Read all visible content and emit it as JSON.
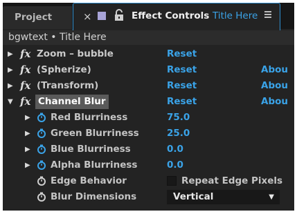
{
  "tabs": {
    "project": "Project",
    "close_symbol": "×",
    "effect_controls_title": "Effect Controls",
    "comp_name": "Title Here",
    "menu_icon": "hamburger-menu-icon",
    "swatch_color": "#a8a4d8",
    "accent_color": "#2f8fd0"
  },
  "header": {
    "text": "bgwtext • Title Here"
  },
  "effects": [
    {
      "name": "Zoom – bubble",
      "reset": "Reset",
      "about": ""
    },
    {
      "name": "(Spherize)",
      "reset": "Reset",
      "about": "Abou"
    },
    {
      "name": "(Transform)",
      "reset": "Reset",
      "about": "Abou"
    },
    {
      "name": "Channel Blur",
      "reset": "Reset",
      "about": "Abou"
    }
  ],
  "fx_label": "fx",
  "properties": [
    {
      "name": "Red Blurriness",
      "value": "75.0"
    },
    {
      "name": "Green Blurriness",
      "value": "25.0"
    },
    {
      "name": "Blue Blurriness",
      "value": "0.0"
    },
    {
      "name": "Alpha Blurriness",
      "value": "0.0"
    }
  ],
  "edge_behavior": {
    "name": "Edge Behavior",
    "checkbox_label": "Repeat Edge Pixels",
    "checked": false
  },
  "blur_dimensions": {
    "name": "Blur Dimensions",
    "value": "Vertical"
  },
  "colors": {
    "link_blue": "#3aa3e8",
    "panel_bg": "#232323"
  }
}
